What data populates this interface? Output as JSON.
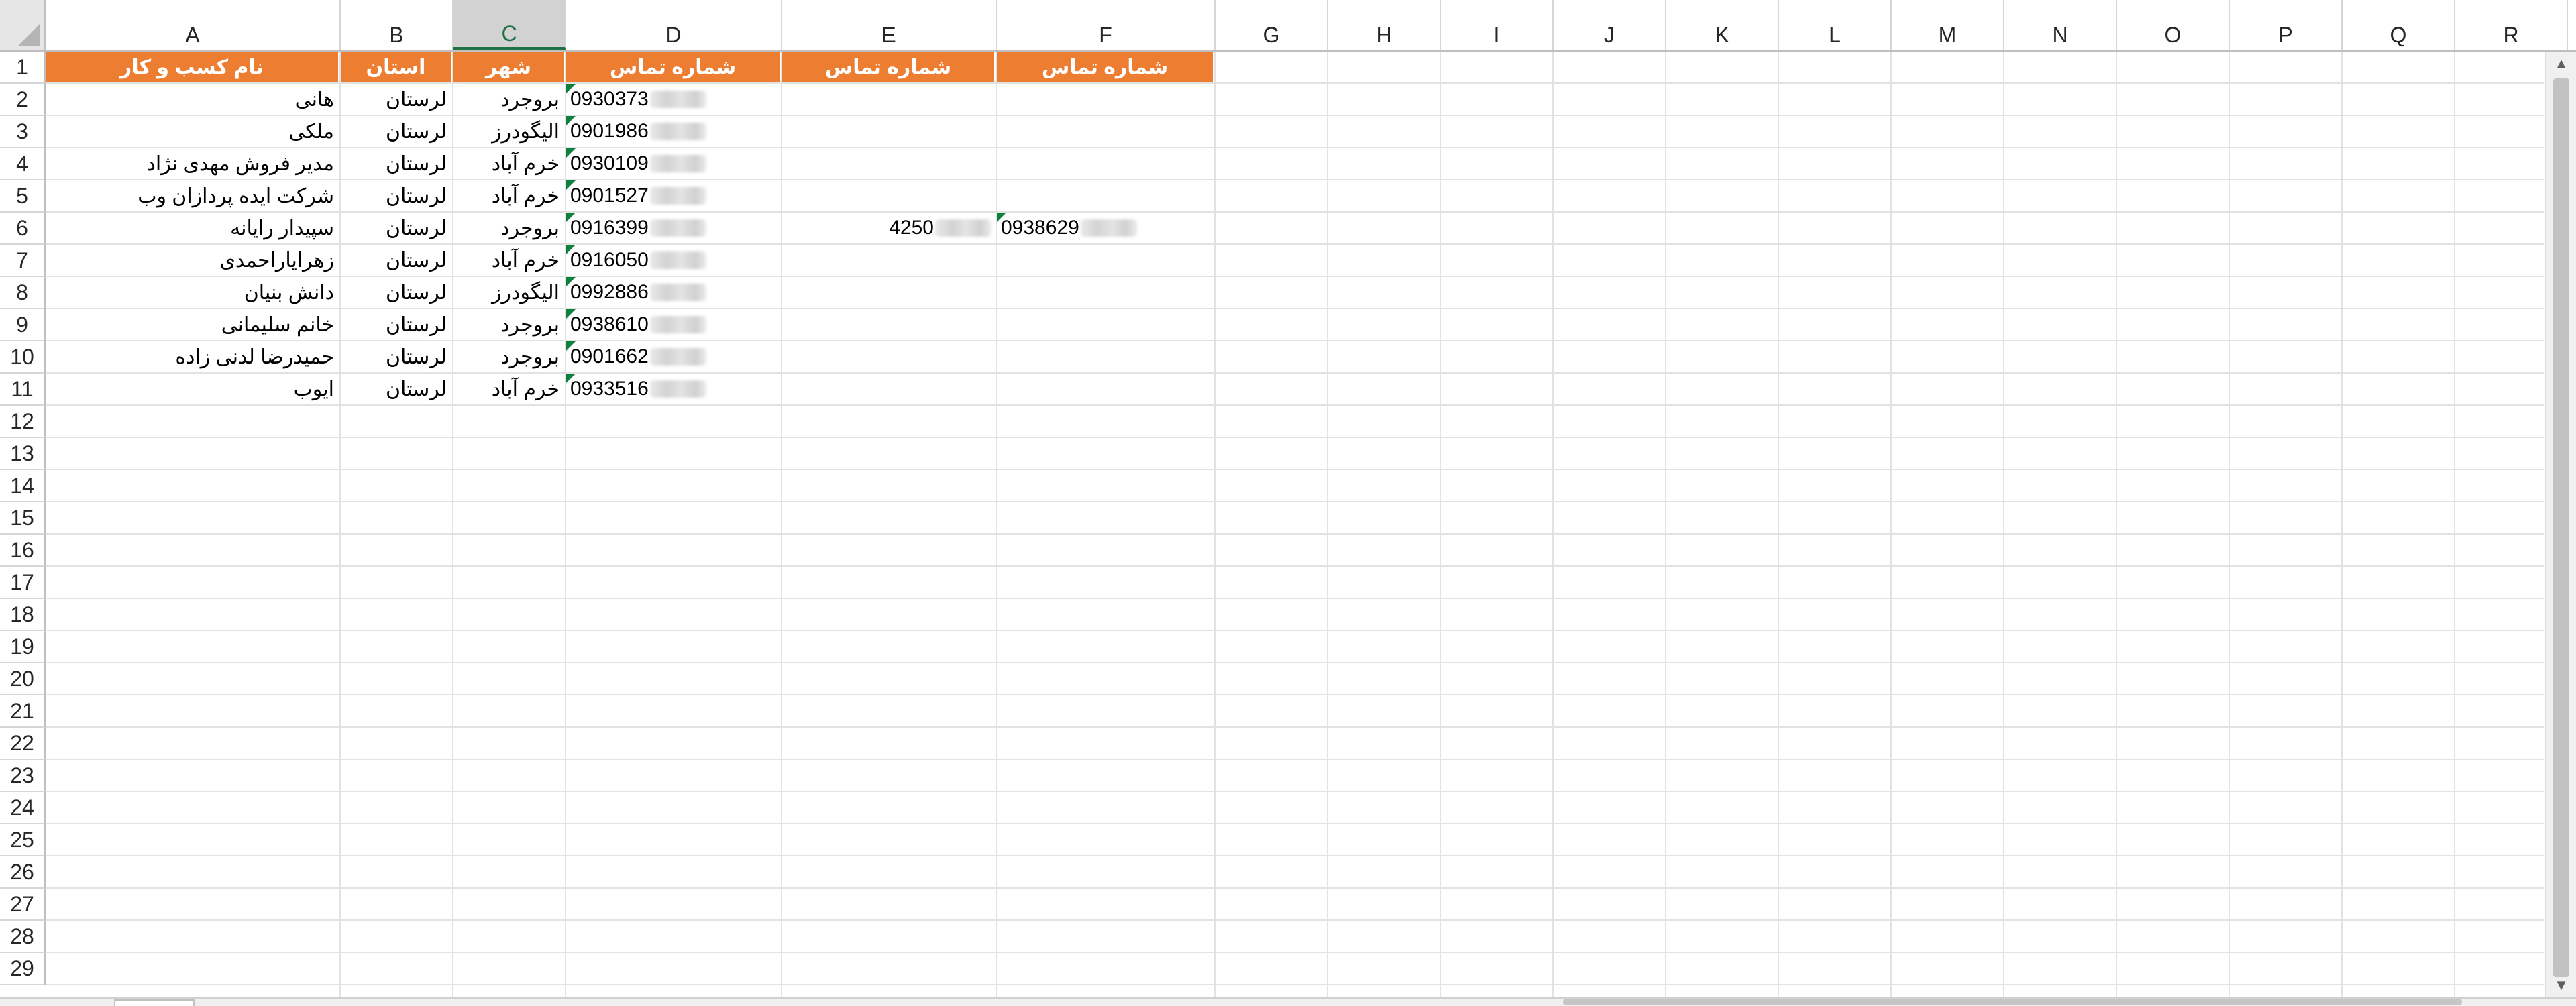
{
  "spreadsheet": {
    "columns": [
      "A",
      "B",
      "C",
      "D",
      "E",
      "F",
      "G",
      "H",
      "I",
      "J",
      "K",
      "L",
      "M",
      "N",
      "O",
      "P",
      "Q",
      "R"
    ],
    "active_column": "C",
    "row_numbers": [
      "1",
      "2",
      "3",
      "4",
      "5",
      "6",
      "7",
      "8",
      "9",
      "10",
      "11",
      "12",
      "13",
      "14",
      "15",
      "16",
      "17",
      "18",
      "19",
      "20",
      "21",
      "22",
      "23",
      "24",
      "25",
      "26",
      "27",
      "28",
      "29"
    ],
    "header_row": {
      "A": "نام کسب و کار",
      "B": "استان",
      "C": "شهر",
      "D": "شماره تماس",
      "E": "شماره تماس",
      "F": "شماره تماس"
    },
    "rows": [
      {
        "name": "هانی",
        "province": "لرستان",
        "city": "بروجرد",
        "phone": "0930373"
      },
      {
        "name": "ملکی",
        "province": "لرستان",
        "city": "الیگودرز",
        "phone": "0901986"
      },
      {
        "name": "مدیر فروش مهدی نژاد",
        "province": "لرستان",
        "city": "خرم آباد",
        "phone": "0930109"
      },
      {
        "name": "شرکت ایده پردازان وب",
        "province": "لرستان",
        "city": "خرم آباد",
        "phone": "0901527"
      },
      {
        "name": "سپیدار رایانه",
        "province": "لرستان",
        "city": "بروجرد",
        "phone": "0916399",
        "phone2": "4250",
        "phone3": "0938629"
      },
      {
        "name": "زهرایاراحمدی",
        "province": "لرستان",
        "city": "خرم آباد",
        "phone": "0916050"
      },
      {
        "name": "دانش بنیان",
        "province": "لرستان",
        "city": "الیگودرز",
        "phone": "0992886"
      },
      {
        "name": "خانم سلیمانی",
        "province": "لرستان",
        "city": "بروجرد",
        "phone": "0938610"
      },
      {
        "name": "حمیدرضا لدنی زاده",
        "province": "لرستان",
        "city": "بروجرد",
        "phone": "0901662"
      },
      {
        "name": "ایوب",
        "province": "لرستان",
        "city": "خرم آباد",
        "phone": "0933516"
      }
    ]
  },
  "colors": {
    "header_fill": "#ed7d31",
    "header_text": "#ffffff",
    "active_header": "#217346",
    "error_indicator": "#108040",
    "gridline": "#e2e2e2"
  },
  "icons": {
    "select_all": "select-all-triangle-icon",
    "text_as_number_flag": "error-indicator-icon",
    "scroll_up": "scroll-up-arrow-icon",
    "scroll_down": "scroll-down-arrow-icon"
  }
}
